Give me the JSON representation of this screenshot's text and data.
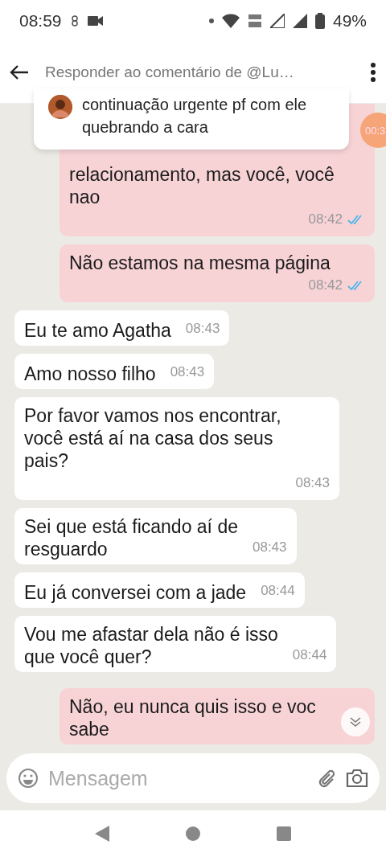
{
  "status_bar": {
    "time": "08:59",
    "battery": "49%"
  },
  "header": {
    "title": "Responder ao comentário de @Lu…"
  },
  "reply_card": {
    "text": "continuação urgente pf com ele quebrando a cara"
  },
  "timer_badge": "00:3",
  "messages": [
    {
      "kind": "outgoing",
      "text": "relacionamento, mas você, você\nnao",
      "time": "08:42",
      "covered_top": true
    },
    {
      "kind": "outgoing",
      "text": "Não estamos na mesma página",
      "time": "08:42"
    },
    {
      "kind": "incoming",
      "text": "Eu te amo Agatha",
      "time": "08:43"
    },
    {
      "kind": "incoming",
      "text": "Amo nosso filho",
      "time": "08:43"
    },
    {
      "kind": "incoming",
      "text": "Por favor vamos nos encontrar,\nvocê está aí na casa dos seus\npais?",
      "time": "08:43"
    },
    {
      "kind": "incoming",
      "text": "Sei que está ficando aí de\nresguardo",
      "time": "08:43"
    },
    {
      "kind": "incoming",
      "text": "Eu já conversei com a jade",
      "time": "08:44"
    },
    {
      "kind": "incoming",
      "text": "Vou me afastar dela não é isso\nque você quer?",
      "time": "08:44"
    },
    {
      "kind": "outgoing",
      "text": "Não, eu nunca quis isso e voc\nsabe"
    }
  ],
  "composer": {
    "placeholder": "Mensagem"
  }
}
